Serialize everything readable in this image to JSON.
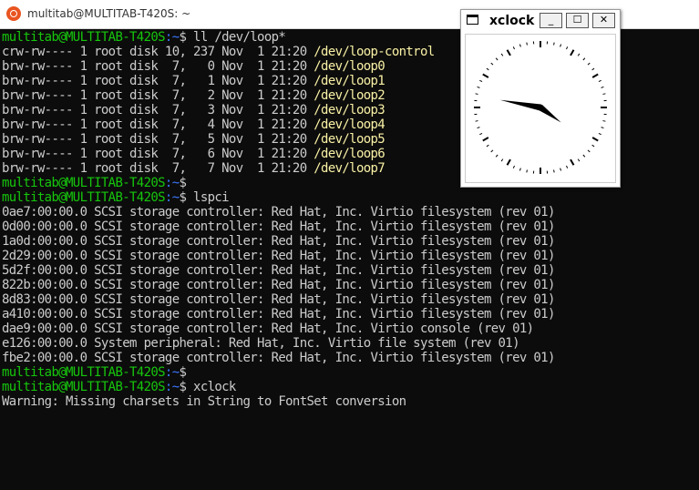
{
  "window": {
    "title": "multitab@MULTITAB-T420S: ~"
  },
  "terminal": {
    "lines": [
      {
        "prompt": "multitab@MULTITAB-T420S",
        "path": ":~",
        "rest": "$ ll /dev/loop*"
      },
      {
        "text": "crw-rw---- 1 root disk 10, 237 Nov  1 21:20 ",
        "dev": "/dev/loop-control"
      },
      {
        "text": "brw-rw---- 1 root disk  7,   0 Nov  1 21:20 ",
        "dev": "/dev/loop0"
      },
      {
        "text": "brw-rw---- 1 root disk  7,   1 Nov  1 21:20 ",
        "dev": "/dev/loop1"
      },
      {
        "text": "brw-rw---- 1 root disk  7,   2 Nov  1 21:20 ",
        "dev": "/dev/loop2"
      },
      {
        "text": "brw-rw---- 1 root disk  7,   3 Nov  1 21:20 ",
        "dev": "/dev/loop3"
      },
      {
        "text": "brw-rw---- 1 root disk  7,   4 Nov  1 21:20 ",
        "dev": "/dev/loop4"
      },
      {
        "text": "brw-rw---- 1 root disk  7,   5 Nov  1 21:20 ",
        "dev": "/dev/loop5"
      },
      {
        "text": "brw-rw---- 1 root disk  7,   6 Nov  1 21:20 ",
        "dev": "/dev/loop6"
      },
      {
        "text": "brw-rw---- 1 root disk  7,   7 Nov  1 21:20 ",
        "dev": "/dev/loop7"
      },
      {
        "prompt": "multitab@MULTITAB-T420S",
        "path": ":~",
        "rest": "$"
      },
      {
        "prompt": "multitab@MULTITAB-T420S",
        "path": ":~",
        "rest": "$ lspci"
      },
      {
        "text": "0ae7:00:00.0 SCSI storage controller: Red Hat, Inc. Virtio filesystem (rev 01)"
      },
      {
        "text": "0d00:00:00.0 SCSI storage controller: Red Hat, Inc. Virtio filesystem (rev 01)"
      },
      {
        "text": "1a0d:00:00.0 SCSI storage controller: Red Hat, Inc. Virtio filesystem (rev 01)"
      },
      {
        "text": "2d29:00:00.0 SCSI storage controller: Red Hat, Inc. Virtio filesystem (rev 01)"
      },
      {
        "text": "5d2f:00:00.0 SCSI storage controller: Red Hat, Inc. Virtio filesystem (rev 01)"
      },
      {
        "text": "822b:00:00.0 SCSI storage controller: Red Hat, Inc. Virtio filesystem (rev 01)"
      },
      {
        "text": "8d83:00:00.0 SCSI storage controller: Red Hat, Inc. Virtio filesystem (rev 01)"
      },
      {
        "text": "a410:00:00.0 SCSI storage controller: Red Hat, Inc. Virtio filesystem (rev 01)"
      },
      {
        "text": "dae9:00:00.0 SCSI storage controller: Red Hat, Inc. Virtio console (rev 01)"
      },
      {
        "text": "e126:00:00.0 System peripheral: Red Hat, Inc. Virtio file system (rev 01)"
      },
      {
        "text": "fbe2:00:00.0 SCSI storage controller: Red Hat, Inc. Virtio filesystem (rev 01)"
      },
      {
        "prompt": "multitab@MULTITAB-T420S",
        "path": ":~",
        "rest": "$"
      },
      {
        "prompt": "multitab@MULTITAB-T420S",
        "path": ":~",
        "rest": "$ xclock"
      },
      {
        "text": "Warning: Missing charsets in String to FontSet conversion"
      }
    ]
  },
  "xclock": {
    "title": "xclock",
    "buttons": {
      "minimize": "_",
      "maximize": "☐",
      "close": "✕"
    },
    "time": {
      "hours": 9,
      "minutes": 21
    }
  },
  "colors": {
    "prompt": "#16c60c",
    "path": "#3b78ff",
    "text": "#cccccc",
    "device": "#f9f1a5",
    "background": "#0c0c0c"
  },
  "icons": {
    "terminal": "ubuntu-logo-icon",
    "xclock": "window-icon"
  }
}
